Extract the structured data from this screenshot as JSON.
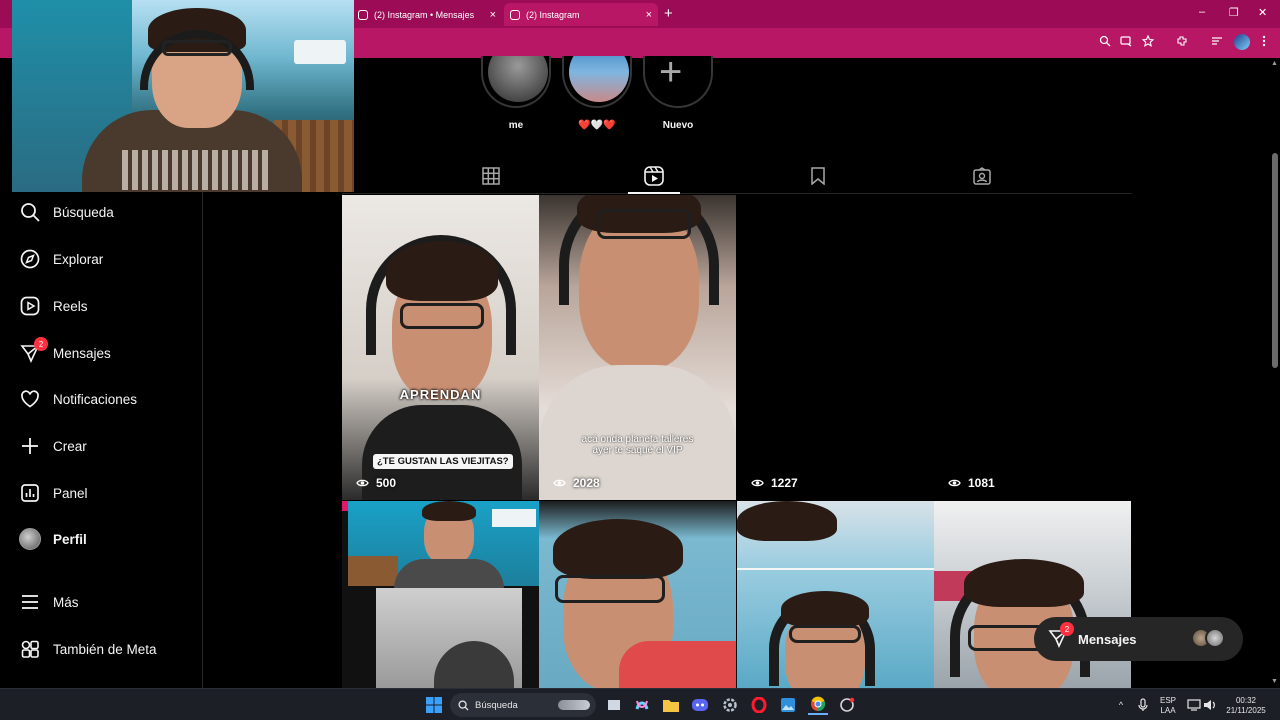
{
  "browser": {
    "tabs": [
      {
        "label": "(2) Instagram • Mensajes",
        "active": false
      },
      {
        "label": "(2) Instagram",
        "active": true
      }
    ],
    "close_glyph": "×",
    "new_tab_glyph": "+",
    "window_controls": [
      "–",
      "❐",
      "✕"
    ],
    "accent_color": "#b81766"
  },
  "highlights": [
    {
      "label": "me"
    },
    {
      "label": "❤️🤍❤️"
    },
    {
      "label": "Nuevo"
    }
  ],
  "sidebar": {
    "items": [
      {
        "label": "Búsqueda",
        "icon": "search-icon"
      },
      {
        "label": "Explorar",
        "icon": "compass-icon"
      },
      {
        "label": "Reels",
        "icon": "reels-icon"
      },
      {
        "label": "Mensajes",
        "icon": "messenger-icon",
        "badge": "2"
      },
      {
        "label": "Notificaciones",
        "icon": "heart-icon"
      },
      {
        "label": "Crear",
        "icon": "plus-icon"
      },
      {
        "label": "Panel",
        "icon": "dashboard-icon"
      },
      {
        "label": "Perfil",
        "icon": "avatar"
      },
      {
        "label": "Más",
        "icon": "menu-icon"
      },
      {
        "label": "También de Meta",
        "icon": "meta-apps-icon"
      }
    ]
  },
  "profile_tabs": [
    "grid-icon",
    "reels-icon",
    "bookmark-icon",
    "tagged-icon"
  ],
  "reels": [
    {
      "views": "500",
      "caption_big": "APRENDAN",
      "caption_box": "¿TE GUSTAN LAS VIEJITAS?"
    },
    {
      "views": "2028",
      "caption_sub": "acá onda planeta talleres\nayer te saqué el VIP"
    },
    {
      "views": "1227"
    },
    {
      "views": "1081"
    }
  ],
  "messages_widget": {
    "label": "Mensajes",
    "badge": "2"
  },
  "taskbar": {
    "search_placeholder": "Búsqueda",
    "lang_line1": "ESP",
    "lang_line2": "LAA",
    "time": "00:32",
    "date": "21/11/2025"
  }
}
